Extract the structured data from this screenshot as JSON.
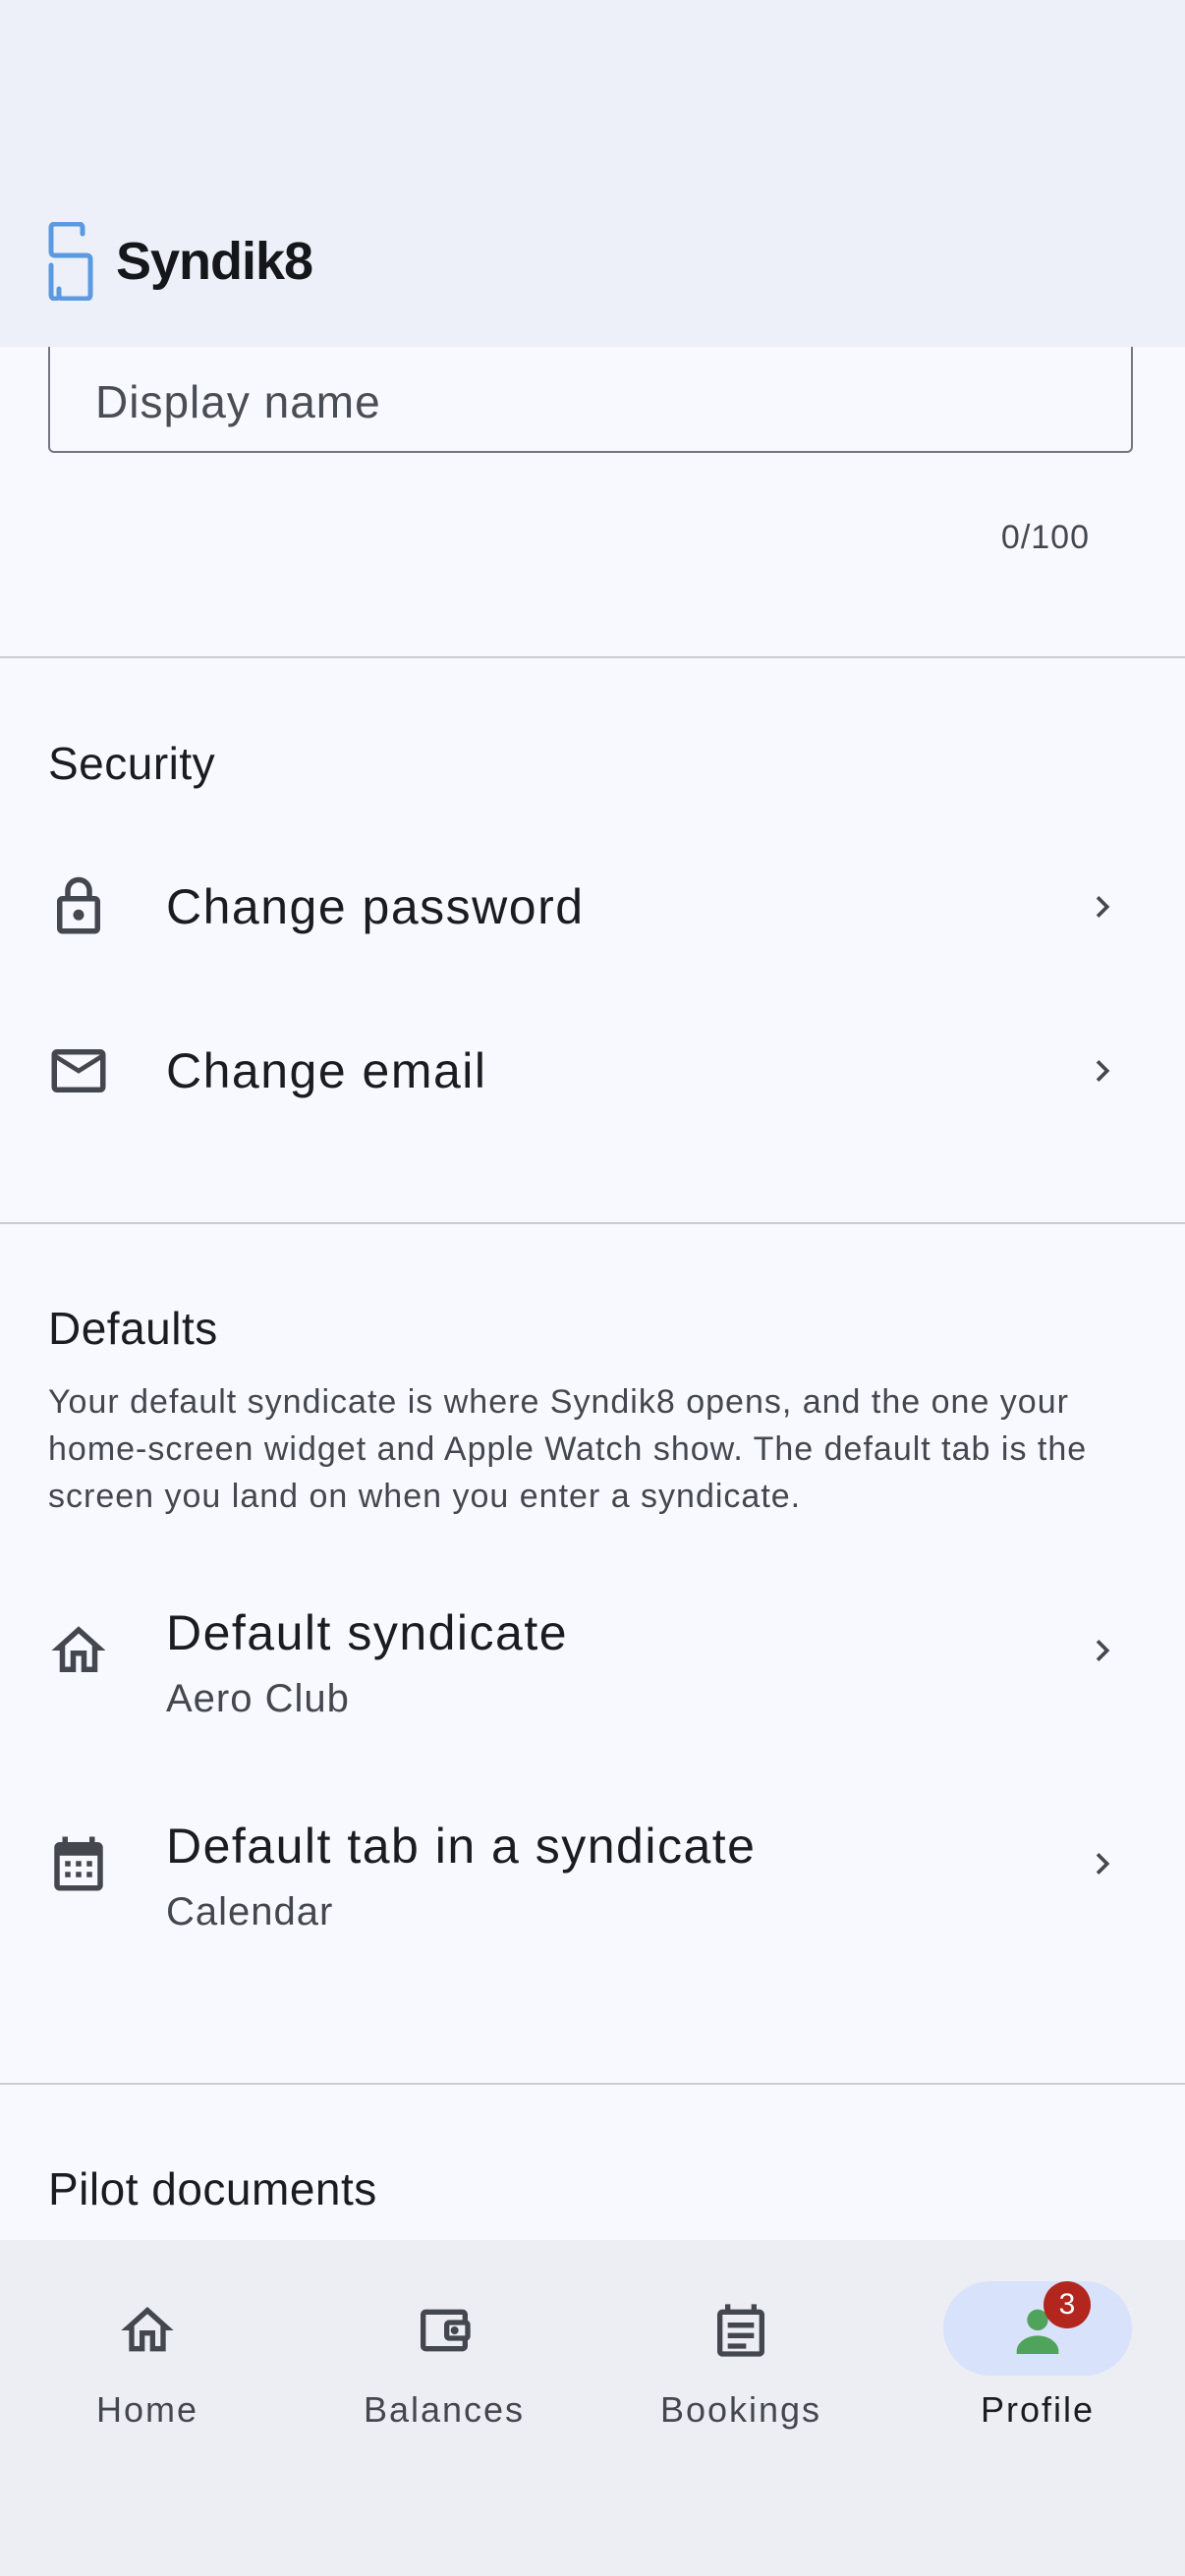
{
  "app": {
    "name": "Syndik8",
    "brand_color": "#5b9ae0"
  },
  "profile_form": {
    "display_name": {
      "value": "",
      "placeholder": "Display name",
      "counter": "0/100"
    }
  },
  "security": {
    "title": "Security",
    "items": [
      {
        "label": "Change password",
        "icon": "lock-icon"
      },
      {
        "label": "Change email",
        "icon": "mail-icon"
      }
    ]
  },
  "defaults": {
    "title": "Defaults",
    "description": "Your default syndicate is where Syndik8 opens, and the one your home-screen widget and Apple Watch show. The default tab is the screen you land on when you enter a syndicate.",
    "items": [
      {
        "label": "Default syndicate",
        "value": "Aero Club",
        "icon": "home-icon"
      },
      {
        "label": "Default tab in a syndicate",
        "value": "Calendar",
        "icon": "calendar-icon"
      }
    ]
  },
  "pilot_documents": {
    "title": "Pilot documents"
  },
  "nav": {
    "items": [
      {
        "label": "Home",
        "icon": "home-icon",
        "active": false
      },
      {
        "label": "Balances",
        "icon": "wallet-icon",
        "active": false
      },
      {
        "label": "Bookings",
        "icon": "bookings-icon",
        "active": false
      },
      {
        "label": "Profile",
        "icon": "person-icon",
        "active": true,
        "badge": "3"
      }
    ],
    "active_color": "#d8e2fa",
    "profile_icon_color": "#4fa35a",
    "badge_color": "#b3261e"
  }
}
